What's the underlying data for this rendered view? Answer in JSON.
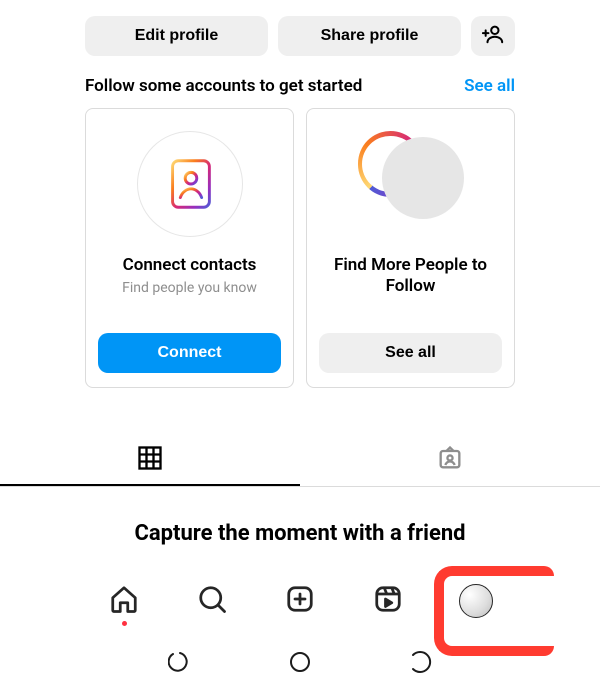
{
  "header_buttons": {
    "edit_profile": "Edit profile",
    "share_profile": "Share profile"
  },
  "suggestions": {
    "title": "Follow some accounts to get started",
    "see_all": "See all",
    "cards": [
      {
        "title": "Connect contacts",
        "subtitle": "Find people you know",
        "action": "Connect"
      },
      {
        "title": "Find More People to Follow",
        "subtitle": "",
        "action": "See all"
      }
    ]
  },
  "cta_text": "Capture the moment with a friend",
  "tabs": {
    "grid_active": true
  },
  "colors": {
    "accent": "#0095f6",
    "annotation": "#ff3b30"
  }
}
